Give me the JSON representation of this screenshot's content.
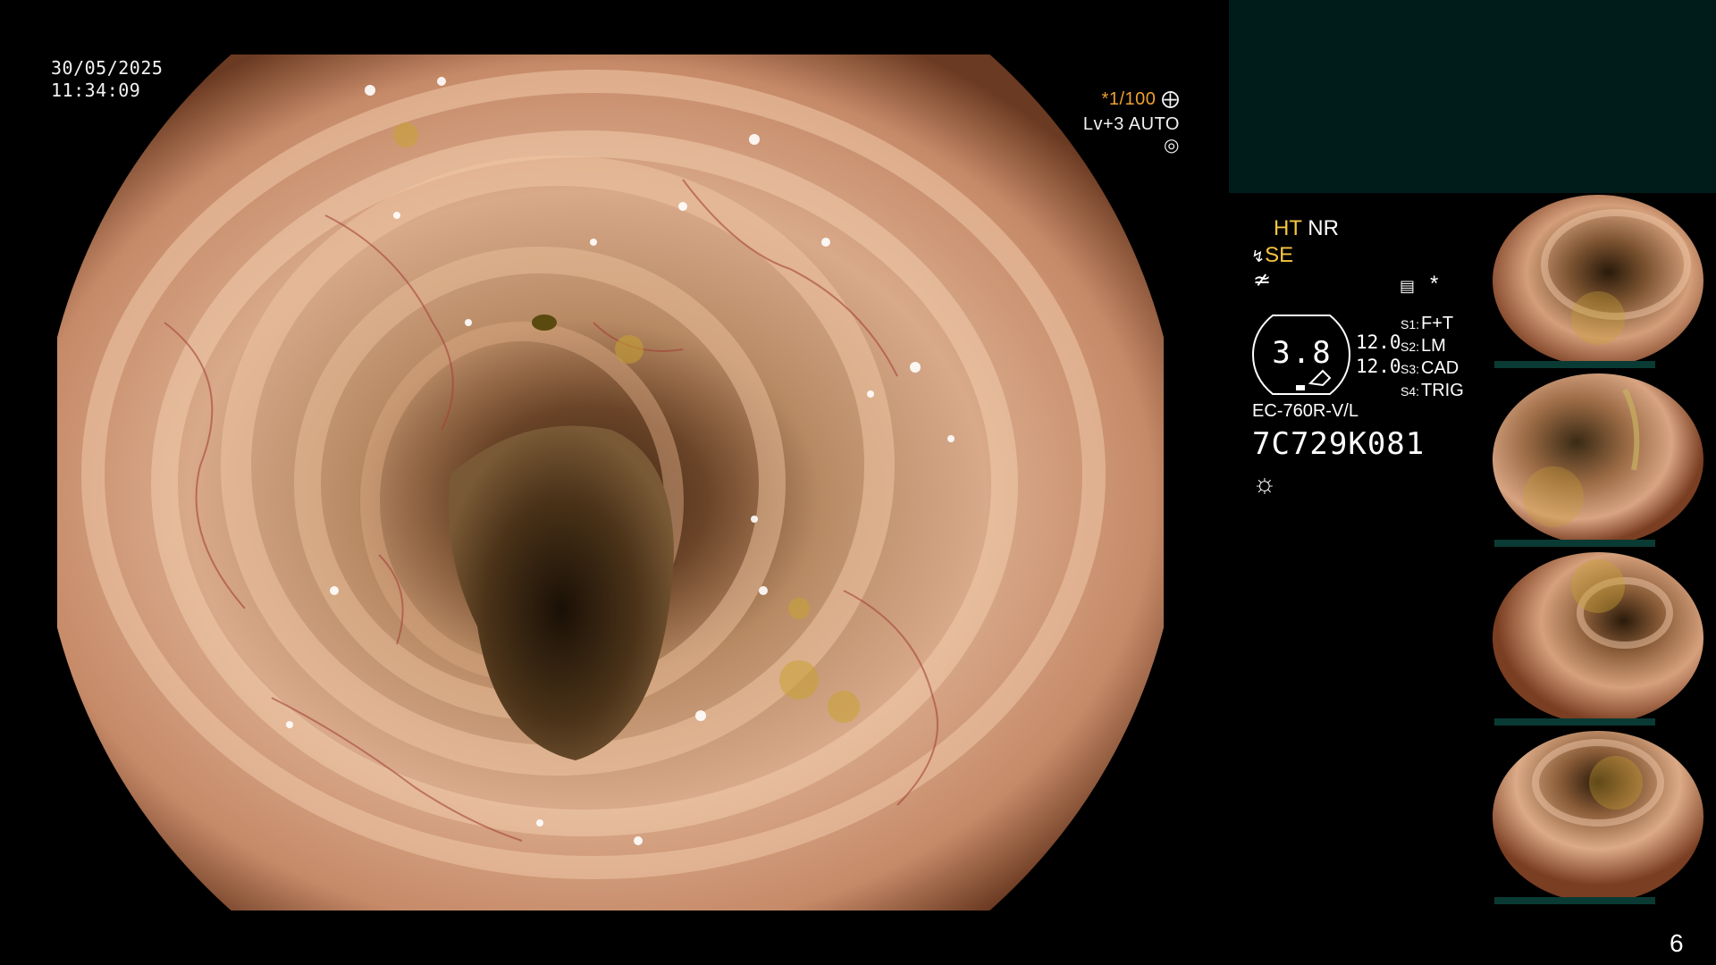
{
  "overlay": {
    "date": "30/05/2025",
    "time": "11:34:09",
    "shutter": "*1/100",
    "shutter_icon": "aperture-icon",
    "level": "Lv+3",
    "mode": "AUTO",
    "mode_icon": "iris-icon"
  },
  "settings": {
    "ht": "HT",
    "nr": "NR",
    "se": "SE",
    "se_icon": "enhancement-icon",
    "filter_icon": "structure-icon",
    "record_icon": "recording-icon",
    "asterisk": "*",
    "dial_value": "3.8",
    "intensity_1": "12.0",
    "intensity_2": "12.0",
    "switches": [
      {
        "key": "S1:",
        "value": "F+T"
      },
      {
        "key": "S2:",
        "value": "LM"
      },
      {
        "key": "S3:",
        "value": "CAD"
      },
      {
        "key": "S4:",
        "value": "TRIG"
      }
    ],
    "scope_model": "EC-760R-V/L",
    "scope_serial": "7C729K081",
    "light_icon": "light-source-icon"
  },
  "thumbnails": {
    "count": 4,
    "serial_text": "7C729K081"
  },
  "page_number": "6",
  "colors": {
    "top_panel": "#001c1a",
    "accent_orange": "#f0a030",
    "accent_yellow": "#f5c542"
  }
}
